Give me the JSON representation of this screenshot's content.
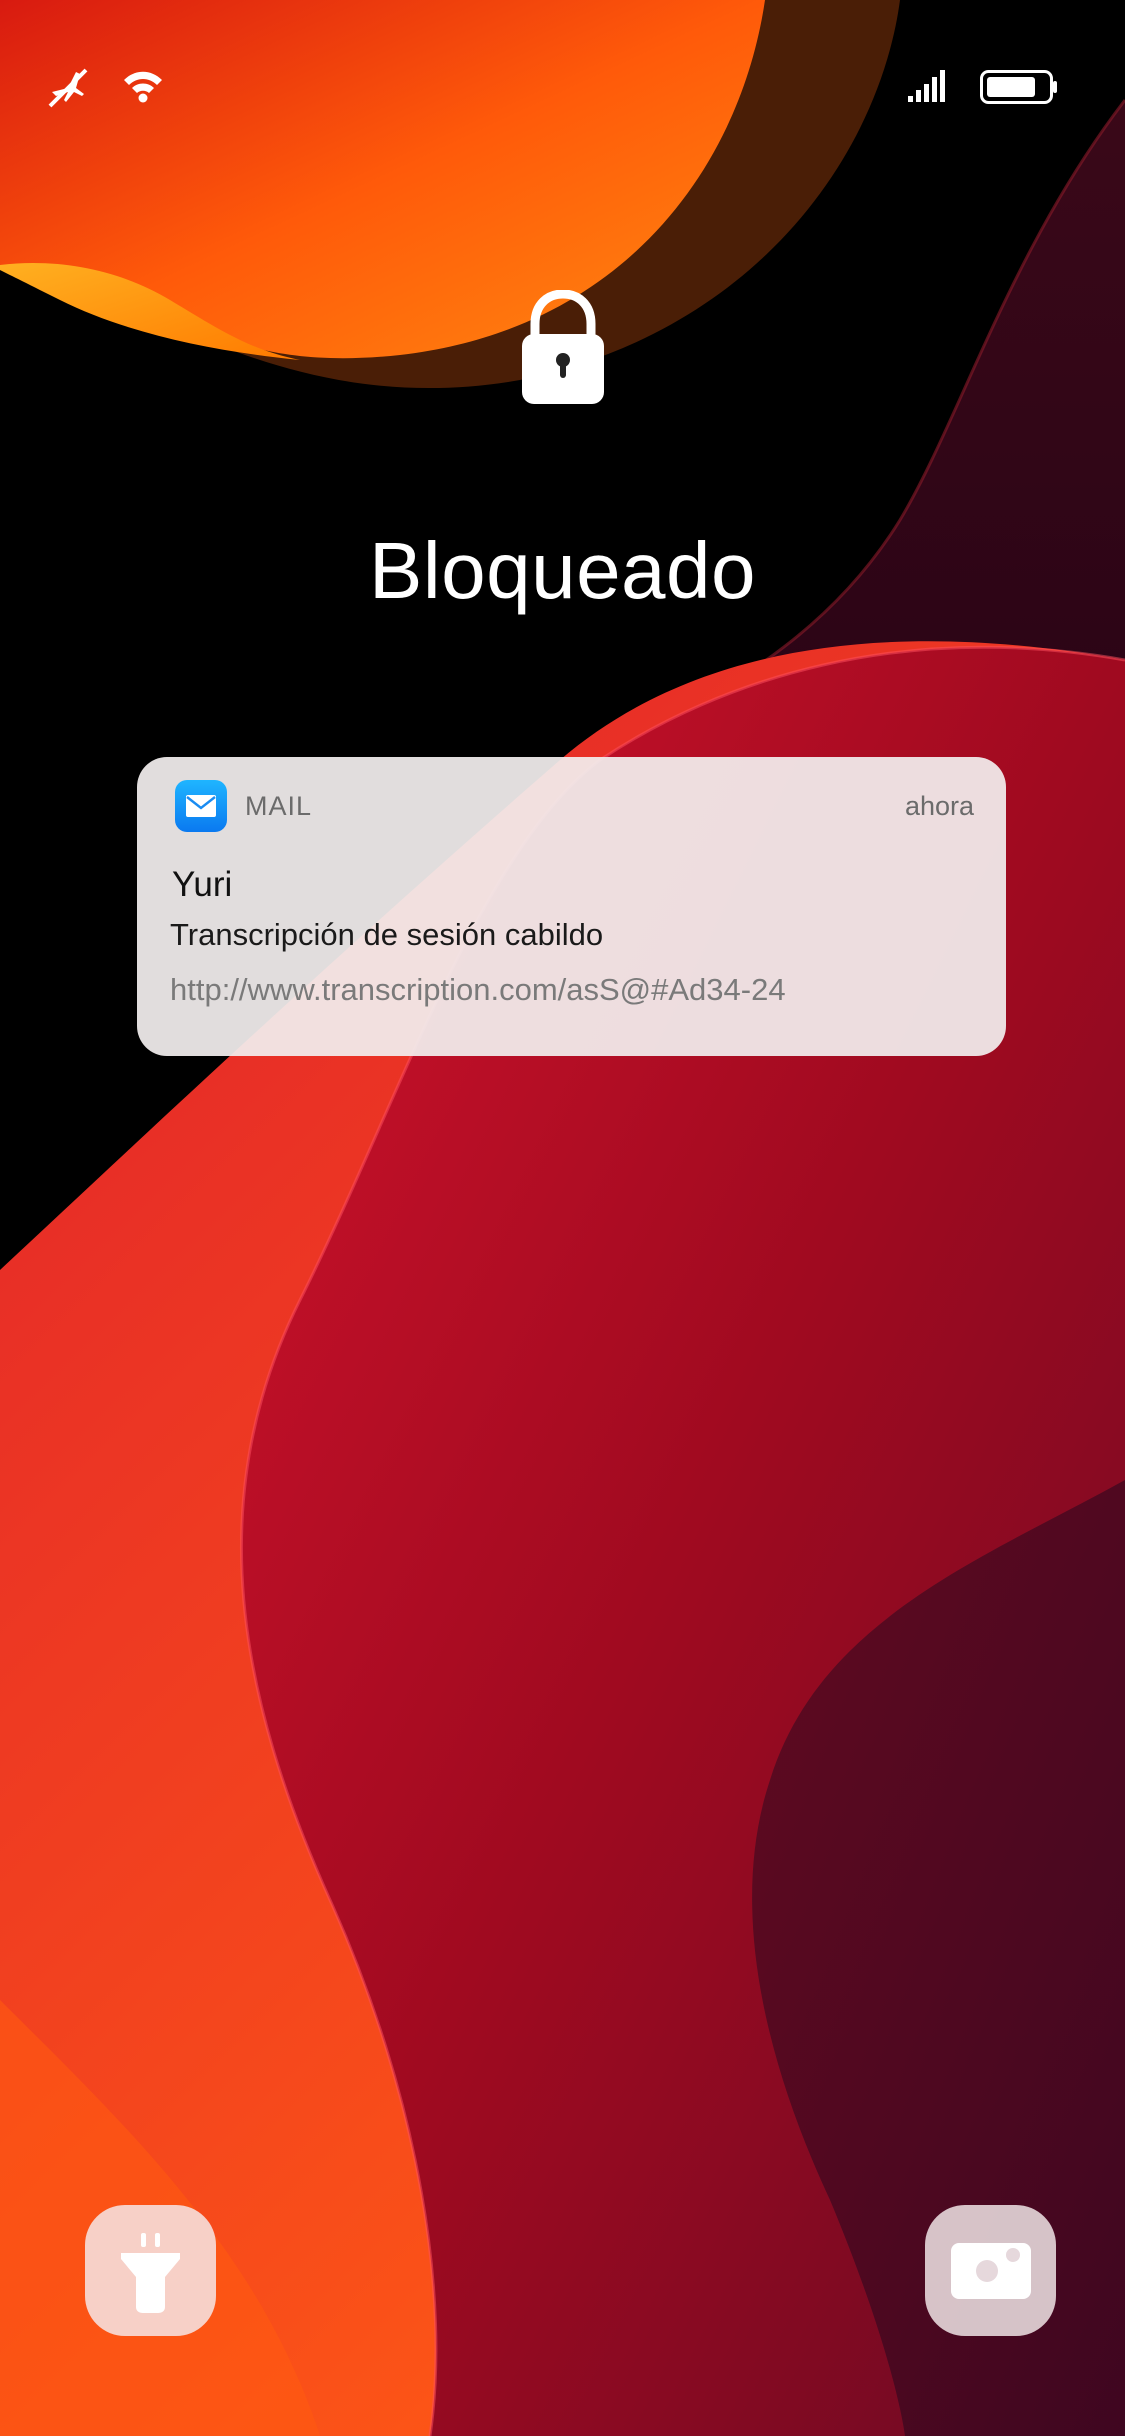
{
  "status_bar": {
    "left_icons": [
      "airplane-mode-off-icon",
      "wifi-icon"
    ],
    "right_icons": [
      "cellular-signal-icon",
      "battery-icon"
    ],
    "battery_level": 0.8
  },
  "lock_screen": {
    "title": "Bloqueado",
    "lock_icon": "lock-icon"
  },
  "notification": {
    "app_icon": "mail-envelope-icon",
    "app_name": "MAIL",
    "time": "ahora",
    "sender": "Yuri",
    "subject": "Transcripción de sesión cabildo",
    "body": "http://www.transcription.com/asS@#Ad34-24"
  },
  "quick_actions": {
    "left": "flashlight-icon",
    "right": "camera-icon"
  },
  "colors": {
    "notification_bg": "#f2eeee",
    "mail_icon_top": "#1fb5ff",
    "mail_icon_bottom": "#0a79f0",
    "wallpaper_orange": "#ff6a10",
    "wallpaper_red": "#c8102e",
    "wallpaper_dark": "#4a0a1e"
  }
}
